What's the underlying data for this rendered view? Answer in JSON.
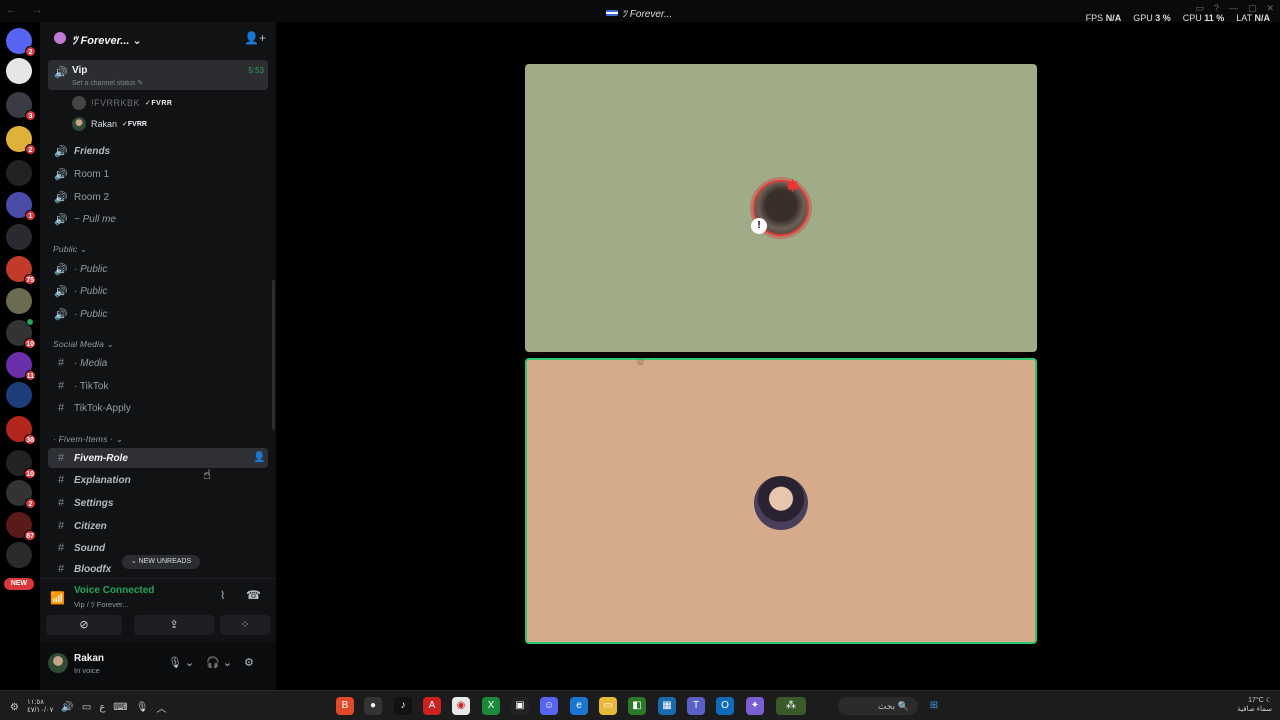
{
  "titlebar": {
    "window_title": "ﾂ Forever...",
    "stats": [
      {
        "label": "FPS",
        "value": "N/A"
      },
      {
        "label": "GPU",
        "value": "3 %"
      },
      {
        "label": "CPU",
        "value": "11 %"
      },
      {
        "label": "LAT",
        "value": "N/A"
      }
    ]
  },
  "server_rail": {
    "badges": [
      "2",
      "3",
      "2",
      "1",
      "75",
      "10",
      "11",
      "38",
      "10",
      "2",
      "87"
    ],
    "new_pill": "NEW"
  },
  "guild": {
    "name": "ﾂ Forever..."
  },
  "vip_channel": {
    "name": "Vip",
    "time": "5:53",
    "status": "Set a channel status",
    "users": [
      {
        "name": "!FVRRKBK",
        "tag": "FVRR"
      },
      {
        "name": "Rakan",
        "tag": "FVRR"
      }
    ]
  },
  "channels": [
    {
      "name": "Friends"
    },
    {
      "name": "Room 1"
    },
    {
      "name": "Room 2"
    },
    {
      "name": "~ Pull me"
    }
  ],
  "categories": {
    "public": "Public",
    "social_media": "Social Media",
    "fivem_items": "· Fivem-Items ·"
  },
  "public_channels": [
    {
      "name": "· Public"
    },
    {
      "name": "· Public"
    },
    {
      "name": "· Public"
    }
  ],
  "social_channels": [
    {
      "name": "· Media"
    },
    {
      "name": "· TikTok"
    },
    {
      "name": "TikTok-Apply"
    }
  ],
  "fivem_channels": [
    {
      "name": "Fivem-Role"
    },
    {
      "name": "Explanation"
    },
    {
      "name": "Settings"
    },
    {
      "name": "Citizen"
    },
    {
      "name": "Sound"
    },
    {
      "name": "Bloodfx"
    }
  ],
  "new_unreads": "NEW UNREADS",
  "voice": {
    "status": "Voice Connected",
    "location": "Vip / ﾂ Forever..."
  },
  "user": {
    "name": "Rakan",
    "status": "In voice"
  },
  "taskbar": {
    "clock_time": "١١:٥٨",
    "clock_date": "٤٧/١٠/٠٧",
    "search_placeholder": "بحث",
    "temperature": "17°C",
    "weather": "سماء صافية"
  },
  "colors": {
    "tile_top": "#a0ab88",
    "tile_bottom": "#d5ab8b",
    "speaking": "#2dc770",
    "accent_green": "#23a55a"
  }
}
